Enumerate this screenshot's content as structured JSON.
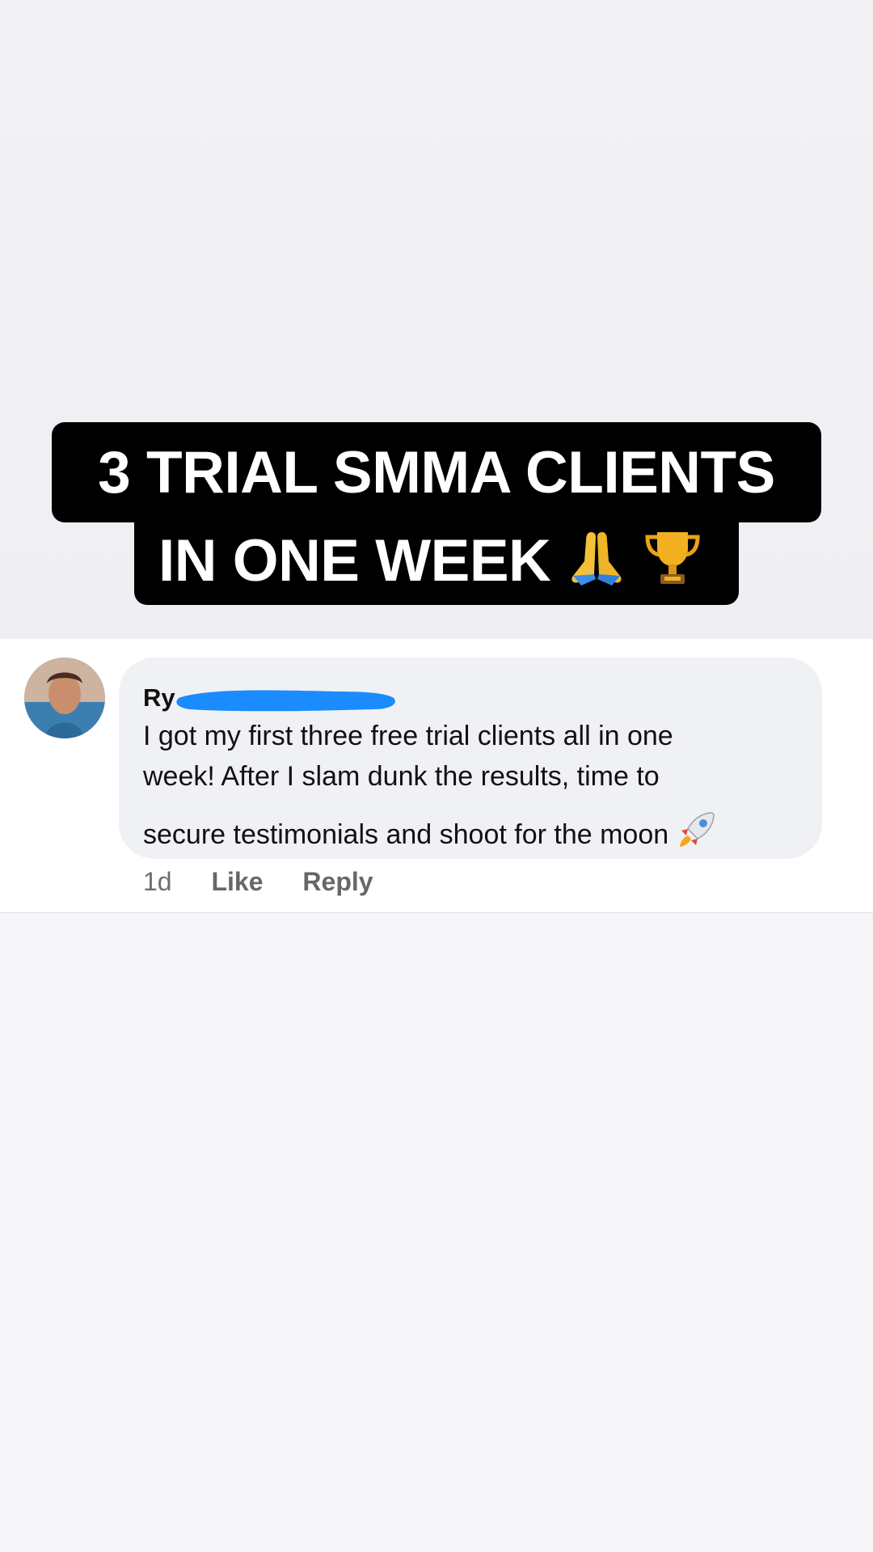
{
  "headline": {
    "line1": "3 TRIAL SMMA CLIENTS",
    "line2": "IN ONE WEEK",
    "emojis": [
      "🙏",
      "🏆"
    ]
  },
  "comment": {
    "author_visible": "Ry",
    "text_line1": "I got my first three free trial clients all in one",
    "text_line2": "week! After I slam dunk the results, time to",
    "text_line3": "secure testimonials and shoot for the moon",
    "text_emoji": "🚀",
    "age": "1d",
    "like_label": "Like",
    "reply_label": "Reply"
  },
  "colors": {
    "redaction_blue": "#1a8cff",
    "caption_bg": "#000000",
    "caption_text": "#ffffff"
  },
  "icons": {
    "avatar": "user-avatar",
    "pray": "praying-hands-icon",
    "trophy": "trophy-icon",
    "rocket": "rocket-icon"
  }
}
